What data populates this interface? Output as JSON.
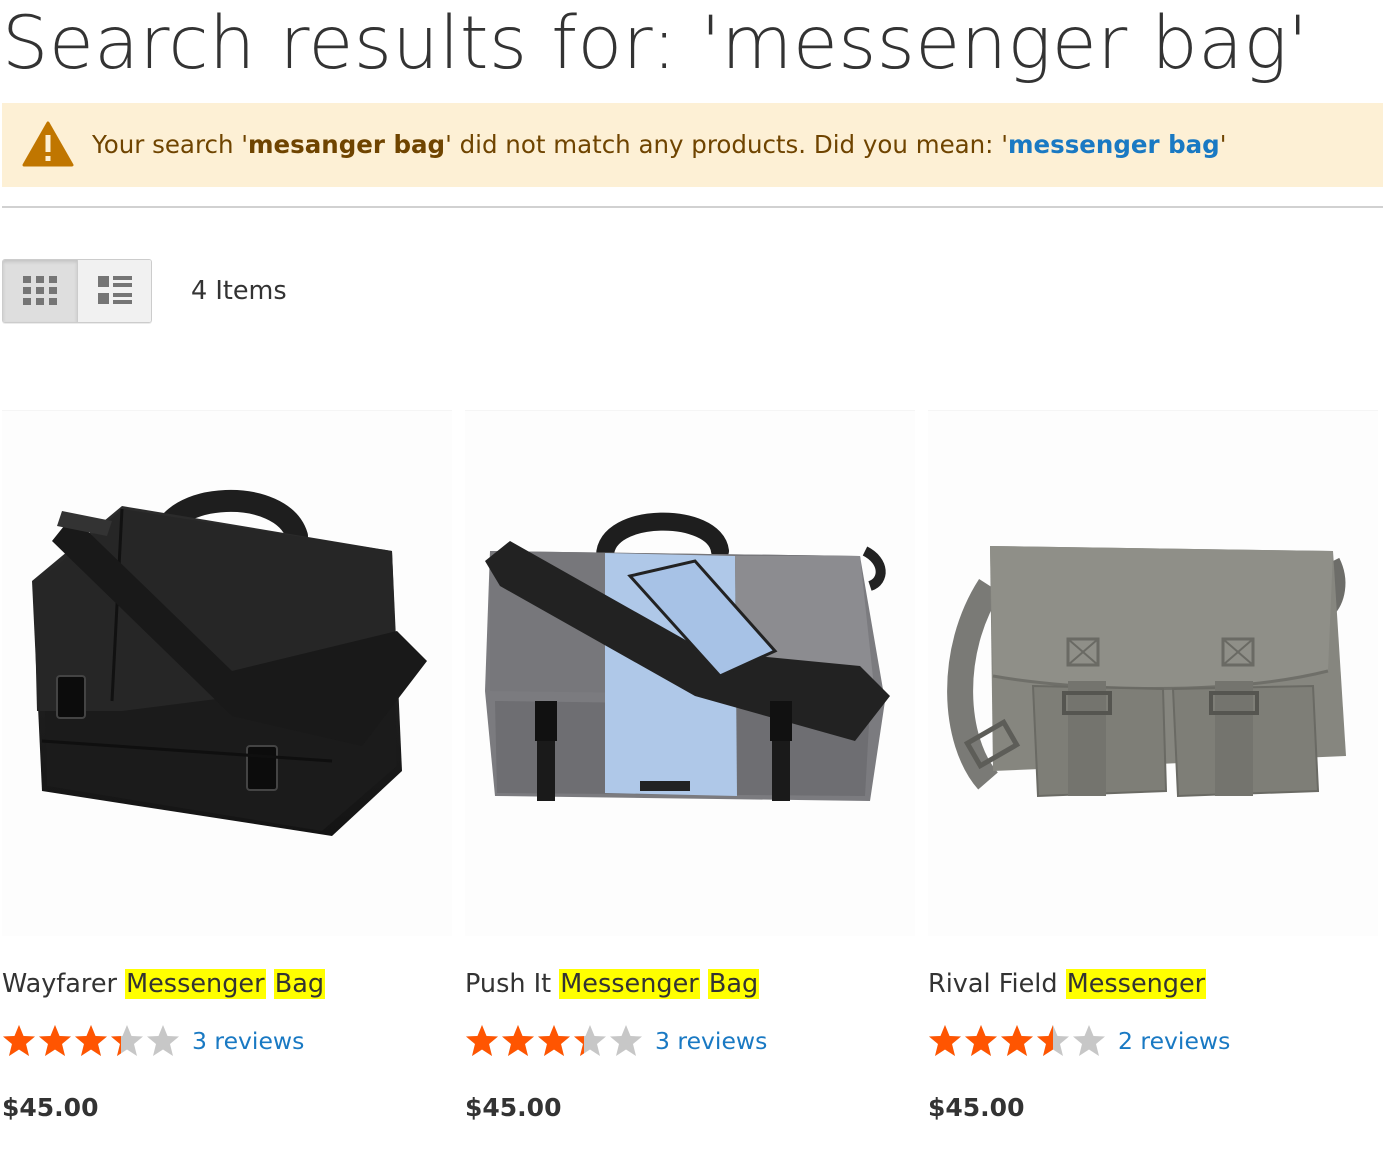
{
  "page": {
    "title": "Search results for: 'messenger bag'"
  },
  "notice": {
    "icon": "warning-icon",
    "text_before": "Your search '",
    "searched_term": "mesanger bag",
    "text_middle": "' did not match any products. Did you mean:  '",
    "suggestion": "messenger bag",
    "text_after": "'"
  },
  "toolbar": {
    "modes": [
      {
        "label": "Grid",
        "icon": "grid-view-icon",
        "active": true
      },
      {
        "label": "List",
        "icon": "list-view-icon",
        "active": false
      }
    ],
    "amount": "4 Items"
  },
  "products": [
    {
      "name_plain": "Wayfarer ",
      "name_highlights": [
        "Messenger",
        "Bag"
      ],
      "rating_percent": 67,
      "reviews": "3 reviews",
      "price": "$45.00",
      "image": "black-messenger-bag"
    },
    {
      "name_plain": "Push It ",
      "name_highlights": [
        "Messenger",
        "Bag"
      ],
      "rating_percent": 67,
      "reviews": "3 reviews",
      "price": "$45.00",
      "image": "gray-blue-messenger-bag"
    },
    {
      "name_plain": "Rival Field ",
      "name_highlights": [
        "Messenger"
      ],
      "rating_percent": 70,
      "reviews": "2 reviews",
      "price": "$45.00",
      "image": "gray-canvas-messenger-bag"
    }
  ],
  "colors": {
    "notice_bg": "#fdf0d5",
    "notice_text": "#6f4400",
    "link": "#1979c3",
    "highlight": "#ffff00",
    "star_on": "#ff5501",
    "star_off": "#c7c7c7"
  }
}
